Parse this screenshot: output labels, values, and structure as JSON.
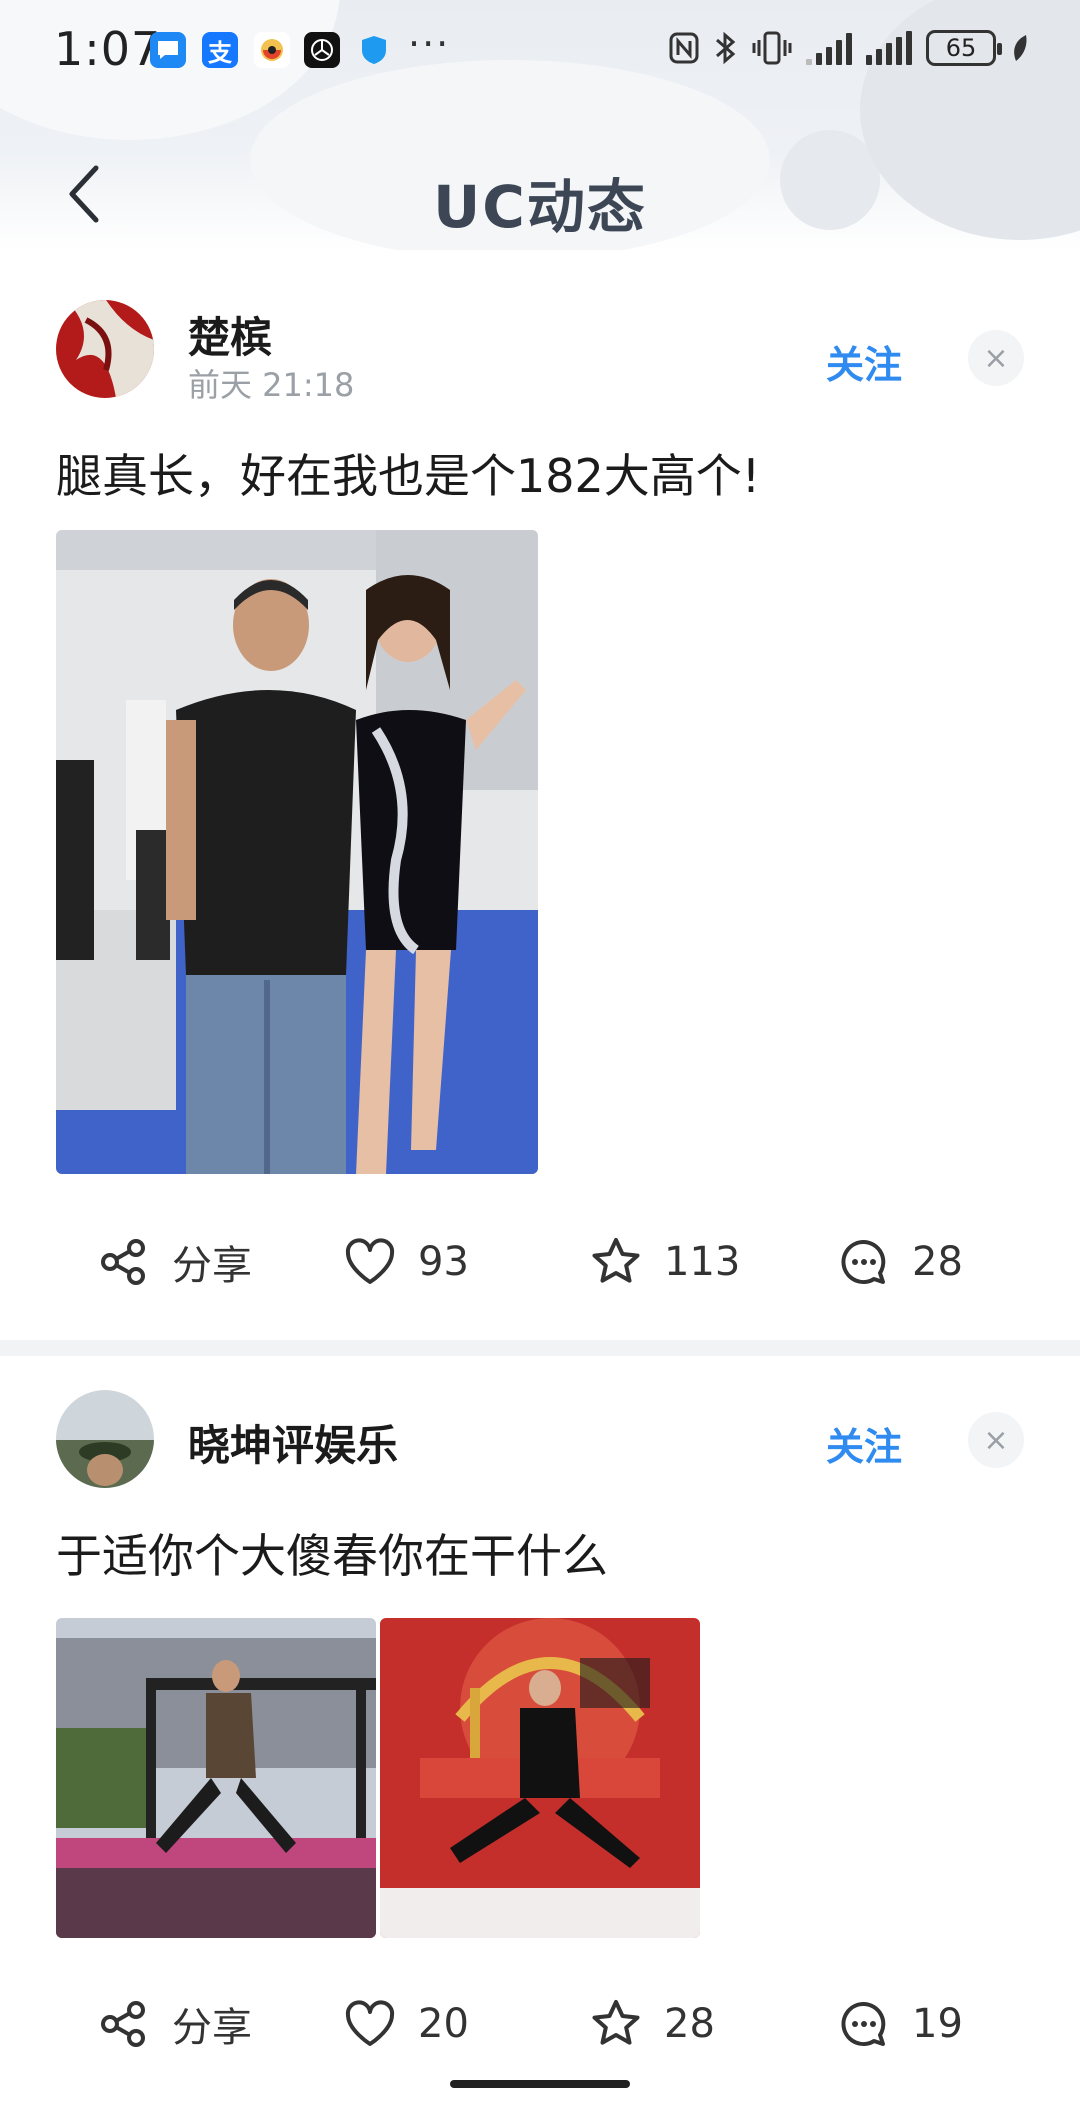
{
  "status_bar": {
    "time": "1:07",
    "battery": "65",
    "more": "···"
  },
  "header": {
    "title": "UC动态"
  },
  "posts": [
    {
      "author": "楚槟",
      "time": "前天 21:18",
      "follow_label": "关注",
      "close_label": "×",
      "text": "腿真长，好在我也是个182大高个!",
      "actions": {
        "share": "分享",
        "likes": "93",
        "favorites": "113",
        "comments": "28"
      }
    },
    {
      "author": "晓坤评娱乐",
      "follow_label": "关注",
      "close_label": "×",
      "text": "于适你个大傻春你在干什么",
      "actions": {
        "share": "分享",
        "likes": "20",
        "favorites": "28",
        "comments": "19"
      }
    }
  ],
  "colors": {
    "accent": "#2f8bf0",
    "title": "#3c4655",
    "muted": "#9aa0a6"
  }
}
